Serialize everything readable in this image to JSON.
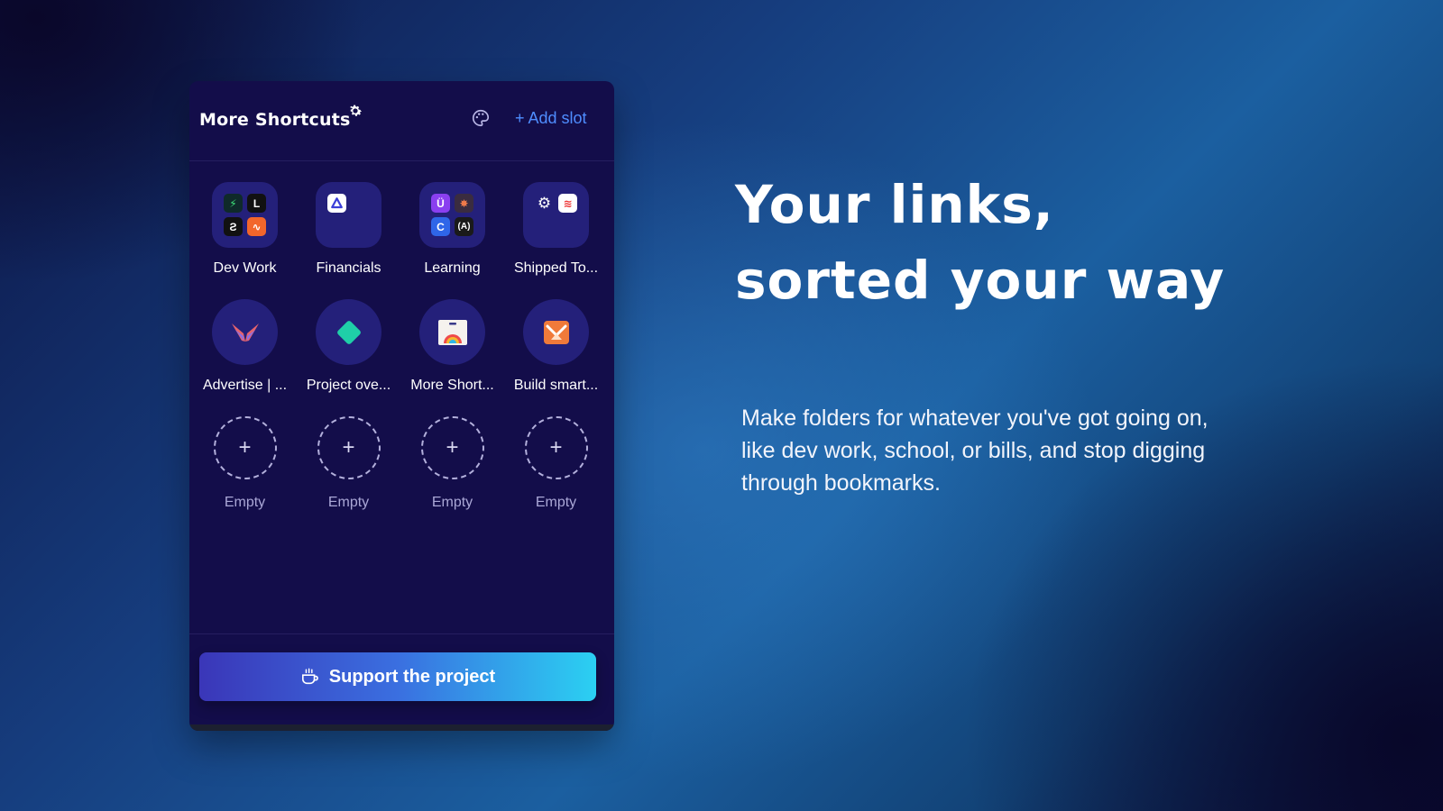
{
  "panel": {
    "brand_title": "More Shortcuts",
    "add_slot_label": "+ Add slot",
    "tiles": [
      {
        "label": "Dev Work",
        "kind": "folder"
      },
      {
        "label": "Financials",
        "kind": "folder"
      },
      {
        "label": "Learning",
        "kind": "folder"
      },
      {
        "label": "Shipped To...",
        "kind": "folder"
      },
      {
        "label": "Advertise | ...",
        "kind": "link"
      },
      {
        "label": "Project ove...",
        "kind": "link"
      },
      {
        "label": "More Short...",
        "kind": "link"
      },
      {
        "label": "Build smart...",
        "kind": "link"
      }
    ],
    "empty_slots": [
      {
        "label": "Empty"
      },
      {
        "label": "Empty"
      },
      {
        "label": "Empty"
      },
      {
        "label": "Empty"
      }
    ],
    "support_label": "Support the project"
  },
  "hero": {
    "headline_line1": "Your links,",
    "headline_line2": "sorted your way",
    "description": "Make folders for whatever you've got going on, like dev work, school, or bills, and stop digging through bookmarks."
  },
  "colors": {
    "panel_bg": "#130d4a",
    "tile_bg": "#24207a",
    "accent_link": "#4f8dff",
    "support_gradient_start": "#3a36b8",
    "support_gradient_end": "#2bd0f2"
  },
  "icons": {
    "brand": "gear-icon",
    "theme": "palette-icon",
    "support": "coffee-cup-icon",
    "empty": "plus-icon"
  }
}
